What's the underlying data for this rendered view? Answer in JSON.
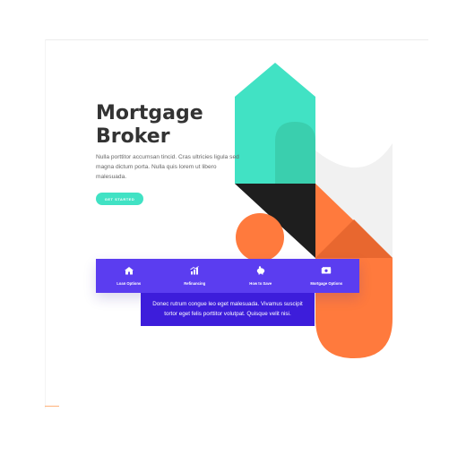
{
  "hero": {
    "title": "Mortgage\nBroker",
    "description": "Nulla porttitor accumsan tincid. Cras ultricies ligula sed magna dictum porta. Nulla quis lorem ut libero malesuada.",
    "cta_label": "GET STARTED"
  },
  "menu": {
    "items": [
      {
        "label": "Loan Options",
        "icon": "house-icon"
      },
      {
        "label": "Refinancing",
        "icon": "bar-chart-icon"
      },
      {
        "label": "How to Save",
        "icon": "piggy-bank-icon"
      },
      {
        "label": "Mortgage Options",
        "icon": "money-icon"
      }
    ]
  },
  "info": {
    "text": "Donec rutrum congue leo eget malesuada. Vivamus suscipit tortor eget felis porttitor volutpat. Quisque velit nisi."
  },
  "colors": {
    "teal": "#41e2c4",
    "orange": "#ff7a3d",
    "dark": "#1e1e1e",
    "purple": "#5b3df0",
    "deep_purple": "#3d1ddb"
  }
}
